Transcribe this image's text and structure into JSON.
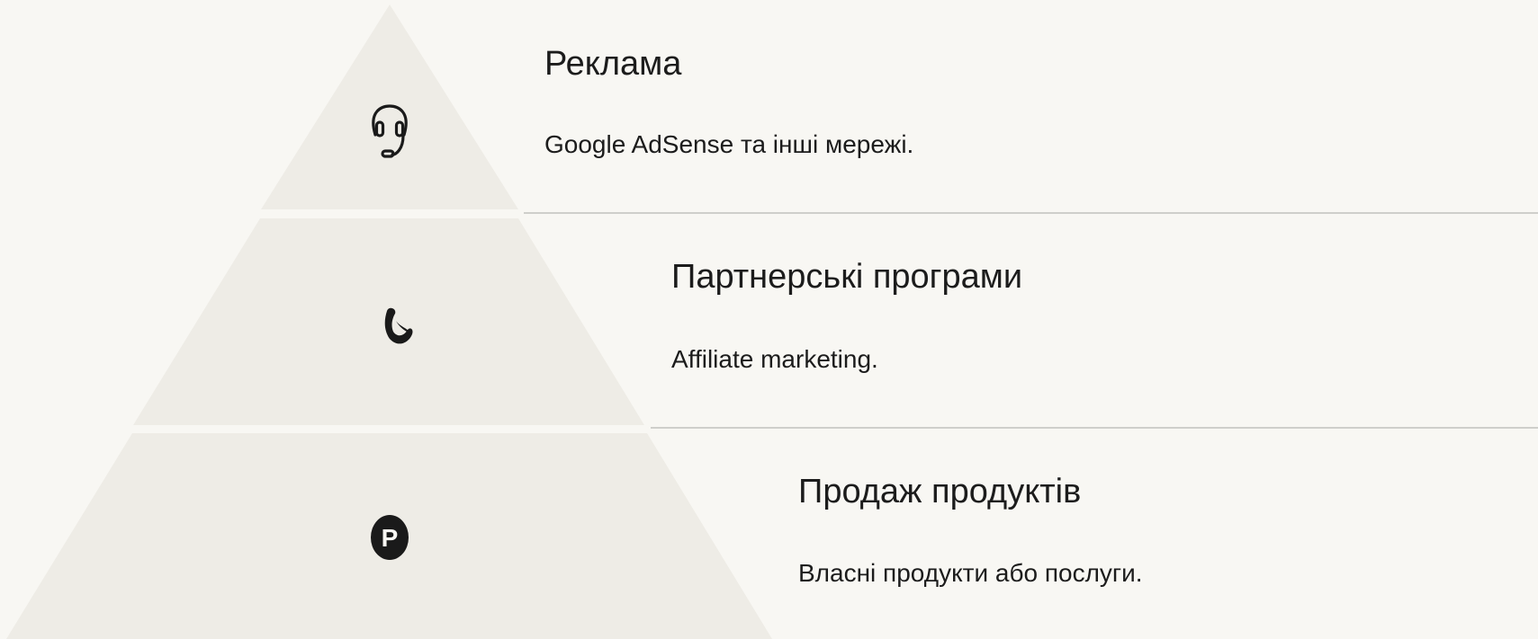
{
  "diagram": {
    "colors": {
      "background": "#f8f7f3",
      "tier_fill": "#eeece6",
      "divider": "#cfcfcb",
      "icon": "#1a1a1a",
      "text": "#1c1c1c"
    },
    "tiers": [
      {
        "icon": "headset-icon",
        "title": "Реклама",
        "description": "Google AdSense та інші мережі."
      },
      {
        "icon": "brush-stroke-icon",
        "title": "Партнерські програми",
        "description": "Affiliate marketing."
      },
      {
        "icon": "product-p-icon",
        "title": "Продаж продуктів",
        "description": "Власні продукти або послуги."
      }
    ]
  }
}
